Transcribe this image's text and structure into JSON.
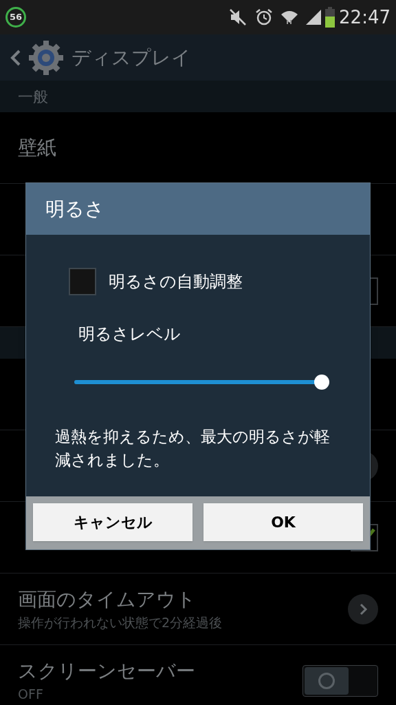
{
  "status_bar": {
    "badge": "56",
    "time": "22:47"
  },
  "action_bar": {
    "title": "ディスプレイ"
  },
  "settings": [
    {
      "kind": "header",
      "title": "一般"
    },
    {
      "kind": "item",
      "title": "壁紙"
    },
    {
      "kind": "item"
    },
    {
      "kind": "checkbox",
      "checked": false
    },
    {
      "kind": "header"
    },
    {
      "kind": "item"
    },
    {
      "kind": "arrow"
    },
    {
      "kind": "checkbox",
      "checked": true
    },
    {
      "kind": "arrow",
      "title": "画面のタイムアウト",
      "subtitle": "操作が行われない状態で2分経過後"
    },
    {
      "kind": "switch",
      "title": "スクリーンセーバー",
      "subtitle": "OFF",
      "on": false
    }
  ],
  "dialog": {
    "title": "明るさ",
    "auto_checkbox": {
      "label": "明るさの自動調整",
      "checked": false
    },
    "level_label": "明るさレベル",
    "slider": {
      "level": 1
    },
    "message": "過熱を抑えるため、最大の明るさが軽減されました。",
    "buttons": [
      "キャンセル",
      "OK"
    ]
  }
}
